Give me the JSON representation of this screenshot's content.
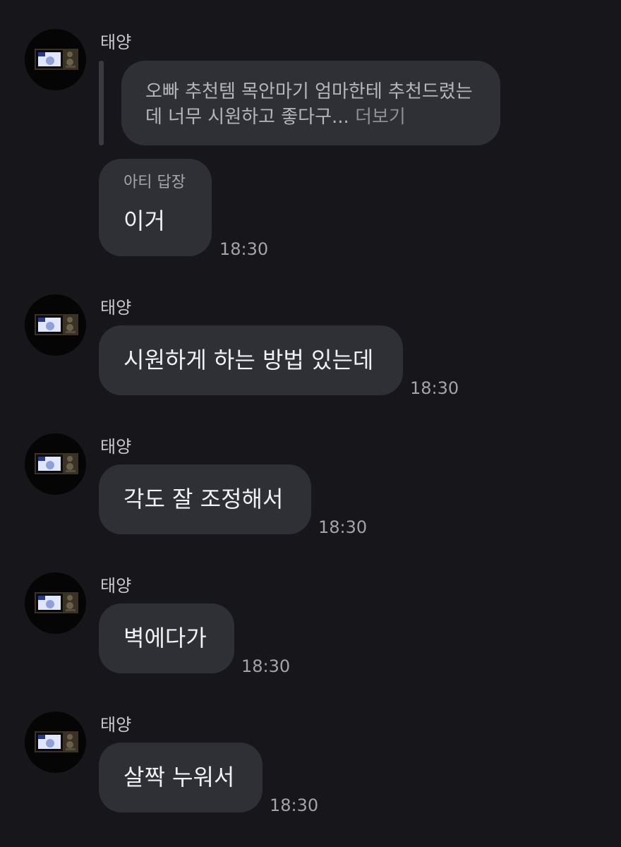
{
  "messages": [
    {
      "sender": "태양",
      "quoted_text": "오빠 추천템 목안마기 엄마한테 추천드렸는데 너무 시원하고 좋다구...",
      "quoted_more": "더보기",
      "reply_label": "아티 답장",
      "text": "이거",
      "time": "18:30"
    },
    {
      "sender": "태양",
      "text": "시원하게 하는 방법 있는데",
      "time": "18:30"
    },
    {
      "sender": "태양",
      "text": "각도 잘 조정해서",
      "time": "18:30"
    },
    {
      "sender": "태양",
      "text": "벽에다가",
      "time": "18:30"
    },
    {
      "sender": "태양",
      "text": "살짝 누워서",
      "time": "18:30"
    }
  ]
}
